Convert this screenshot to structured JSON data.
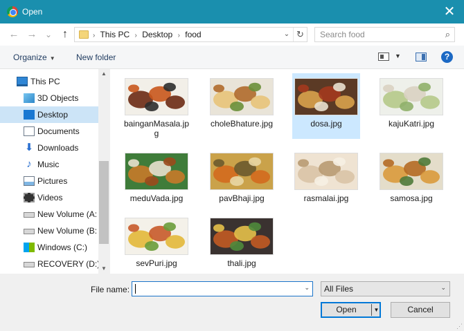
{
  "window": {
    "title": "Open",
    "close_glyph": "✕"
  },
  "nav": {
    "back_glyph": "←",
    "forward_glyph": "→",
    "recent_glyph": "⌄",
    "up_glyph": "↑",
    "breadcrumbs": [
      "This PC",
      "Desktop",
      "food"
    ],
    "separator": "›",
    "search_placeholder": "Search food"
  },
  "toolbar": {
    "organize_label": "Organize",
    "new_folder_label": "New folder",
    "help_label": "?"
  },
  "sidebar": {
    "items": [
      {
        "label": "This PC",
        "icon": "computer-icon",
        "selected": false
      },
      {
        "label": "3D Objects",
        "icon": "3d-objects-icon",
        "selected": false
      },
      {
        "label": "Desktop",
        "icon": "desktop-icon",
        "selected": true
      },
      {
        "label": "Documents",
        "icon": "documents-icon",
        "selected": false
      },
      {
        "label": "Downloads",
        "icon": "downloads-icon",
        "selected": false
      },
      {
        "label": "Music",
        "icon": "music-icon",
        "selected": false
      },
      {
        "label": "Pictures",
        "icon": "pictures-icon",
        "selected": false
      },
      {
        "label": "Videos",
        "icon": "videos-icon",
        "selected": false
      },
      {
        "label": "New Volume (A:",
        "icon": "drive-icon",
        "selected": false
      },
      {
        "label": "New Volume (B:",
        "icon": "drive-icon",
        "selected": false
      },
      {
        "label": "Windows (C:)",
        "icon": "windows-drive-icon",
        "selected": false
      },
      {
        "label": "RECOVERY (D:)",
        "icon": "drive-icon",
        "selected": false
      }
    ]
  },
  "files": [
    {
      "name": "bainganMasala.jpg",
      "selected": false,
      "palette": [
        "#f2efe8",
        "#6b2a14",
        "#c9571c",
        "#2e2e2e"
      ]
    },
    {
      "name": "choleBhature.jpg",
      "selected": false,
      "palette": [
        "#e9e4d8",
        "#e8c37a",
        "#b06a2c",
        "#6a8f3a"
      ]
    },
    {
      "name": "dosa.jpg",
      "selected": true,
      "palette": [
        "#5b3a25",
        "#d8a24c",
        "#a33a1e",
        "#e9e1cf"
      ]
    },
    {
      "name": "kajuKatri.jpg",
      "selected": false,
      "palette": [
        "#eef0ea",
        "#b5c98a",
        "#d9d2c2",
        "#8fb06a"
      ]
    },
    {
      "name": "meduVada.jpg",
      "selected": false,
      "palette": [
        "#3f7c3a",
        "#c77a2a",
        "#e8e1cf",
        "#9b4a1c"
      ]
    },
    {
      "name": "pavBhaji.jpg",
      "selected": false,
      "palette": [
        "#caa24a",
        "#d36a1e",
        "#6b5a2e",
        "#e8d7a5"
      ]
    },
    {
      "name": "rasmalai.jpg",
      "selected": false,
      "palette": [
        "#efe3d2",
        "#d9c3a6",
        "#b89a72",
        "#f6efe3"
      ]
    },
    {
      "name": "samosa.jpg",
      "selected": false,
      "palette": [
        "#e4ddca",
        "#d99a3c",
        "#b46a24",
        "#4f7a3a"
      ]
    },
    {
      "name": "sevPuri.jpg",
      "selected": false,
      "palette": [
        "#f4f1e9",
        "#e3b83a",
        "#c85a2a",
        "#6a9c3a"
      ]
    },
    {
      "name": "thali.jpg",
      "selected": false,
      "palette": [
        "#3a3230",
        "#c25a24",
        "#e6c04a",
        "#4f8a3c"
      ]
    }
  ],
  "footer": {
    "file_name_label": "File name:",
    "file_name_value": "",
    "filter_value": "All Files",
    "open_label": "Open",
    "cancel_label": "Cancel"
  },
  "colors": {
    "titlebar": "#1a8fae",
    "selection": "#cce8ff",
    "accent": "#0078d7"
  }
}
